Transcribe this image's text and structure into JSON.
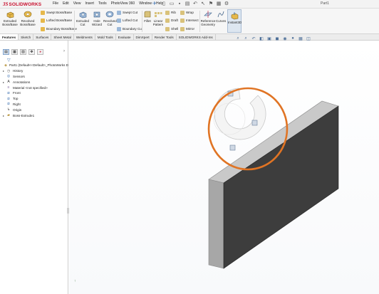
{
  "app": {
    "logo_mark": "3S",
    "logo_text": "SOLIDWORKS",
    "document_title": "Part1"
  },
  "menu": [
    "File",
    "Edit",
    "View",
    "Insert",
    "Tools",
    "PhotoView 360",
    "Window",
    "Help"
  ],
  "ribbon": {
    "extruded_boss": "Extruded Boss/Base",
    "revolved_boss": "Revolved Boss/Base",
    "swept_boss": "Swept Boss/Base",
    "lofted_boss": "Lofted Boss/Base",
    "boundary_boss": "Boundary Boss/Base",
    "extruded_cut": "Extruded Cut",
    "hole_wizard": "Hole Wizard",
    "revolved_cut": "Revolved Cut",
    "swept_cut": "Swept Cut",
    "lofted_cut": "Lofted Cut",
    "boundary_cut": "Boundary Cut",
    "fillet": "Fillet",
    "linear_pattern": "Linear Pattern",
    "rib": "Rib",
    "draft": "Draft",
    "shell": "Shell",
    "wrap": "Wrap",
    "intersect": "Intersect",
    "mirror": "Mirror",
    "reference_geometry": "Reference Geometry",
    "curves": "Curves",
    "instant3d": "Instant3D"
  },
  "tabs": [
    "Features",
    "Sketch",
    "Surfaces",
    "Sheet Metal",
    "Weldments",
    "Mold Tools",
    "Evaluate",
    "DimXpert",
    "Render Tools",
    "SOLIDWORKS Add-Ins"
  ],
  "feature_tree": [
    {
      "label": "Part1  (Default<<Default>_PhotoWorks D",
      "icon": "part-icon",
      "expander": ""
    },
    {
      "label": "History",
      "icon": "history-icon",
      "expander": "▸"
    },
    {
      "label": "Sensors",
      "icon": "sensors-icon",
      "expander": ""
    },
    {
      "label": "Annotations",
      "icon": "annotations-icon",
      "expander": "▸"
    },
    {
      "label": "Material <not specified>",
      "icon": "material-icon",
      "expander": ""
    },
    {
      "label": "Front",
      "icon": "plane-icon",
      "expander": ""
    },
    {
      "label": "Top",
      "icon": "plane-icon",
      "expander": ""
    },
    {
      "label": "Right",
      "icon": "plane-icon",
      "expander": ""
    },
    {
      "label": "Origin",
      "icon": "origin-icon",
      "expander": ""
    },
    {
      "label": "Boss-Extrude1",
      "icon": "extrude-icon",
      "expander": "▸"
    }
  ],
  "colors": {
    "brand": "#c8102e",
    "highlight_circle": "#e07424",
    "part_face_front": "#3d3d3d",
    "part_face_side": "#a7a7a7",
    "part_face_top": "#c9c9c9"
  }
}
